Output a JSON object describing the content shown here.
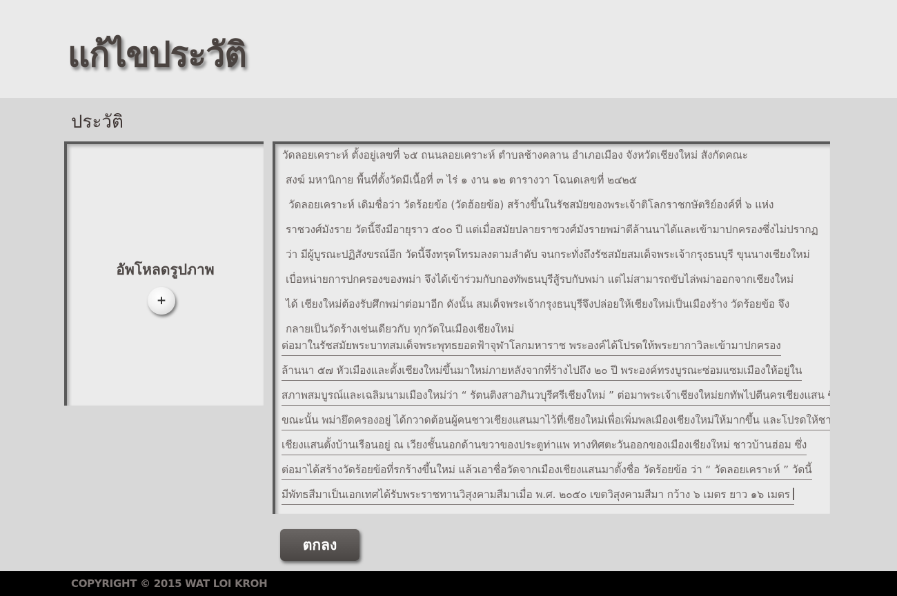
{
  "header": {
    "title": "แก้ไขประวัติ"
  },
  "section": {
    "title": "ประวัติ"
  },
  "upload": {
    "label": "อัพโหลดรูปภาพ",
    "button_label": "+",
    "button_icon": "plus-icon"
  },
  "history": {
    "lines": [
      "วัดลอยเคราะห์ ตั้งอยู่เลขที่ ๖๕ ถนนลอยเคราะห์ ตำบลช้างคลาน อำเภอเมือง จังหวัดเชียงใหม่ สังกัดคณะ",
      "สงฆ์ มหานิกาย พื้นที่ตั้งวัดมีเนื้อที่ ๓ ไร่ ๑ งาน ๑๒ ตารางวา โฉนดเลขที่ ๒๔๒๕",
      "วัดลอยเคราะห์ เดิมชื่อว่า วัดร้อยข้อ (วัดฮ้อยข้อ) สร้างขึ้นในรัชสมัยของพระเจ้าติโลกราชกษัตริย์องค์ที่ ๖ แห่ง",
      "ราชวงศ์มังราย วัดนี้จึงมีอายุราว ๕๐๐ ปี แต่เมื่อสมัยปลายราชวงศ์มังรายพม่าตีล้านนาได้และเข้ามาปกครองซึ่งไม่ปรากฏ",
      "ว่า มีผู้บูรณะปฏิสังขรณ์อีก วัดนี้จึงทรุดโทรมลงตามลำดับ จนกระทั่งถึงรัชสมัยสมเด็จพระเจ้ากรุงธนบุรี ขุนนางเชียงใหม่",
      "เบื่อหน่ายการปกครองของพม่า จึงได้เข้าร่วมกับกองทัพธนบุรีสู้รบกับพม่า แต่ไม่สามารถขับไล่พม่าออกจากเชียงใหม่",
      "ได้ เชียงใหม่ต้องรับศึกพม่าต่อมาอีก ดังนั้น สมเด็จพระเจ้ากรุงธนบุรีจึงปล่อยให้เชียงใหม่เป็นเมืองร้าง วัดร้อยข้อ จึง",
      "กลายเป็นวัดร้างเช่นเดียวกับ ทุกวัดในเมืองเชียงใหม่"
    ],
    "underlined_lines": [
      "ต่อมาในรัชสมัยพระบาทสมเด็จพระพุทธยอดฟ้าจุฬาโลกมหาราช พระองค์ได้โปรดให้พระยากาวิละเข้ามาปกครอง",
      "ล้านนา ๕๗ หัวเมืองและตั้งเชียงใหม่ขึ้นมาใหม่ภายหลังจากที่ร้างไปถึง ๒๐ ปี พระองค์ทรงบูรณะซ่อมแซมเมืองให้อยู่ใน",
      "สภาพสมบูรณ์และเฉลิมนามเมืองใหม่ว่า “ รัตนติงสาอภินวบุรีศรีเชียงใหม่ ” ต่อมาพระเจ้าเชียงใหม่ยกทัพไปตีนครเชียงแสน ซึ่ง",
      "ขณะนั้น พม่ายึดครองอยู่ ได้กวาดต้อนผู้คนชาวเชียงแสนมาไว้ที่เชียงใหม่เพื่อเพิ่มพลเมืองเชียงใหม่ให้มากขึ้น และโปรดให้ชาว",
      "เชียงแสนตั้งบ้านเรือนอยู่ ณ เวียงชั้นนอกด้านขวาของประตูท่าแพ ทางทิศตะวันออกของเมืองเชียงใหม่ ชาวบ้านฮ่อม ซึ่ง",
      "ต่อมาได้สร้างวัดร้อยข้อที่รกร้างขึ้นใหม่ แล้วเอาชื่อวัดจากเมืองเชียงแสนมาตั้งชื่อ วัดร้อยข้อ ว่า “ วัดลอยเคราะห์ ” วัดนี้",
      "มีพัทธสีมาเป็นเอกเทศได้รับพระราชทานวิสุงคามสีมาเมื่อ พ.ศ. ๒๐๕๐ เขตวิสุงคามสีมา กว้าง ๖ เมตร ยาว ๑๖ เมตร"
    ]
  },
  "submit": {
    "label": "ตกลง"
  },
  "footer": {
    "copyright": "COPYRIGHT © 2015 WAT LOI KROH"
  }
}
